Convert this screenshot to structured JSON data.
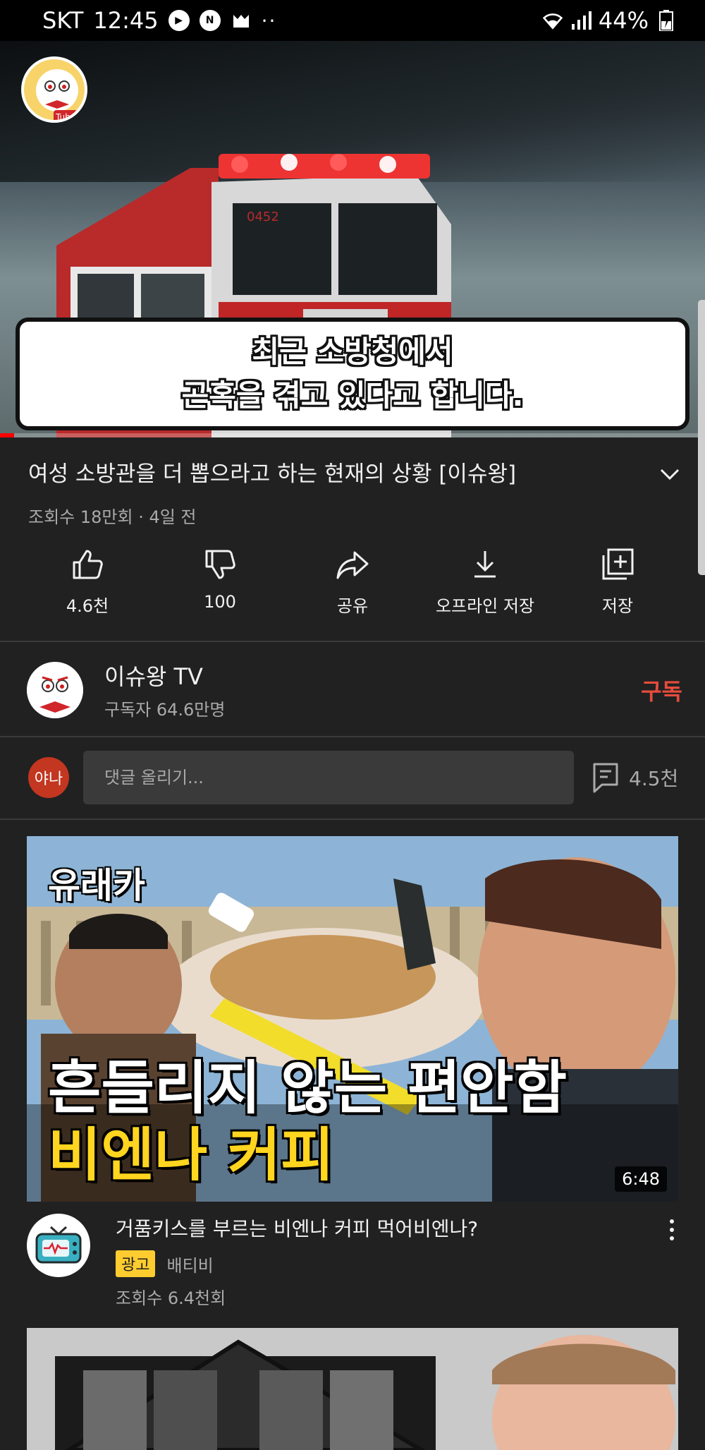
{
  "status_bar": {
    "carrier": "SKT",
    "time": "12:45",
    "battery": "44%"
  },
  "video": {
    "caption_line1": "최근 소방청에서",
    "caption_line2": "곤혹을 겪고 있다고 합니다.",
    "progress": 0.02,
    "watermark_text": "Tube",
    "truck_number": "0452"
  },
  "details": {
    "title": "여성 소방관을 더 뽑으라고 하는 현재의 상황 [이슈왕]",
    "meta": "조회수 18만회 · 4일 전"
  },
  "actions": [
    {
      "label": "4.6천",
      "icon": "thumbs-up-icon"
    },
    {
      "label": "100",
      "icon": "thumbs-down-icon"
    },
    {
      "label": "공유",
      "icon": "share-icon"
    },
    {
      "label": "오프라인 저장",
      "icon": "download-icon"
    },
    {
      "label": "저장",
      "icon": "add-to-playlist-icon"
    }
  ],
  "channel": {
    "name": "이슈왕 TV",
    "subscribers": "구독자 64.6만명",
    "subscribe_label": "구독"
  },
  "comments": {
    "user_avatar_text": "야나",
    "placeholder": "댓글 올리기...",
    "count": "4.5천"
  },
  "recommendation": {
    "thumb_tag": "유래카",
    "thumb_line1": "흔들리지 않는 편안함",
    "thumb_line2": "비엔나 커피",
    "duration": "6:48",
    "title": "거품키스를 부르는 비엔나 커피 먹어비엔나?",
    "ad_badge": "광고",
    "channel": "배티비",
    "views": "조회수 6.4천회"
  },
  "colors": {
    "background": "#212121",
    "subscribe": "#e74c3c",
    "progress": "#ff0000",
    "ad_badge": "#ffcc2f"
  }
}
